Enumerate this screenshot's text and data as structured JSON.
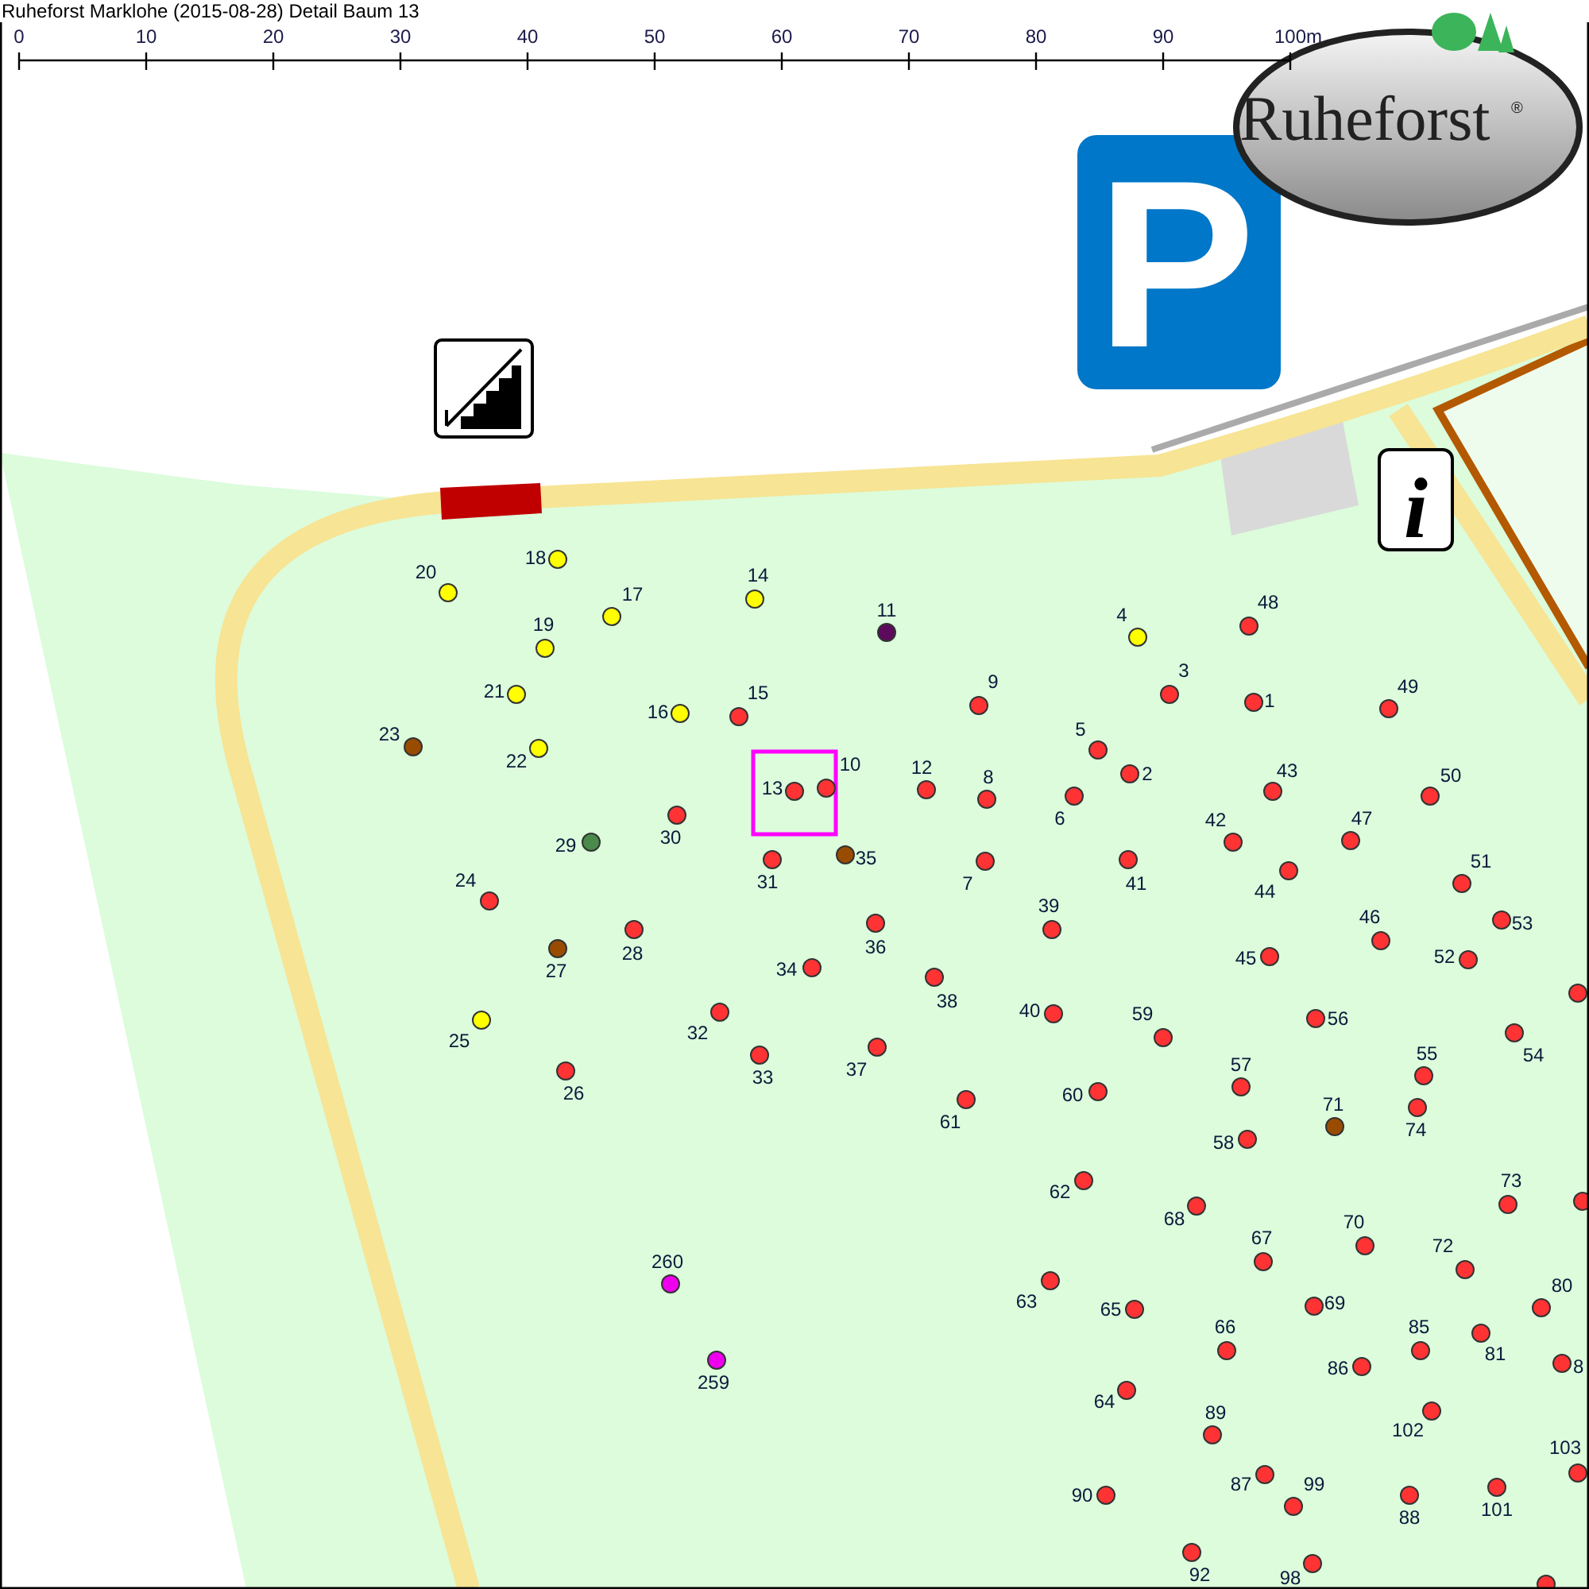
{
  "title": "Ruheforst Marklohe (2015-08-28) Detail  Baum 13",
  "scale_bar": {
    "ticks": [
      "0",
      "10",
      "20",
      "30",
      "40",
      "50",
      "60",
      "70",
      "80",
      "90"
    ],
    "end_label": "100m"
  },
  "logo": {
    "text": "Ruheforst",
    "mark": "®"
  },
  "parking_sign": {
    "letter": "P"
  },
  "info_sign": {
    "letter": "i"
  },
  "trees": [
    {
      "label": "20",
      "color": "#ffff00",
      "selected": false
    },
    {
      "label": "18",
      "color": "#ffff00",
      "selected": false
    },
    {
      "label": "17",
      "color": "#ffff00",
      "selected": false
    },
    {
      "label": "14",
      "color": "#ffff00",
      "selected": false
    },
    {
      "label": "19",
      "color": "#ffff00",
      "selected": false
    },
    {
      "label": "11",
      "color": "#5c0a5c",
      "selected": false
    },
    {
      "label": "4",
      "color": "#ffff00",
      "selected": false
    },
    {
      "label": "48",
      "color": "#ff3333",
      "selected": false
    },
    {
      "label": "21",
      "color": "#ffff00",
      "selected": false
    },
    {
      "label": "16",
      "color": "#ffff00",
      "selected": false
    },
    {
      "label": "15",
      "color": "#ff3333",
      "selected": false
    },
    {
      "label": "9",
      "color": "#ff3333",
      "selected": false
    },
    {
      "label": "3",
      "color": "#ff3333",
      "selected": false
    },
    {
      "label": "1",
      "color": "#ff3333",
      "selected": false
    },
    {
      "label": "49",
      "color": "#ff3333",
      "selected": false
    },
    {
      "label": "23",
      "color": "#994c00",
      "selected": false
    },
    {
      "label": "22",
      "color": "#ffff00",
      "selected": false
    },
    {
      "label": "5",
      "color": "#ff3333",
      "selected": false
    },
    {
      "label": "13",
      "color": "#ff3333",
      "selected": true
    },
    {
      "label": "10",
      "color": "#ff3333",
      "selected": false
    },
    {
      "label": "12",
      "color": "#ff3333",
      "selected": false
    },
    {
      "label": "8",
      "color": "#ff3333",
      "selected": false
    },
    {
      "label": "2",
      "color": "#ff3333",
      "selected": false
    },
    {
      "label": "6",
      "color": "#ff3333",
      "selected": false
    },
    {
      "label": "43",
      "color": "#ff3333",
      "selected": false
    },
    {
      "label": "50",
      "color": "#ff3333",
      "selected": false
    },
    {
      "label": "42",
      "color": "#ff3333",
      "selected": false
    },
    {
      "label": "47",
      "color": "#ff3333",
      "selected": false
    },
    {
      "label": "30",
      "color": "#ff3333",
      "selected": false
    },
    {
      "label": "29",
      "color": "#4a8a4a",
      "selected": false
    },
    {
      "label": "35",
      "color": "#994c00",
      "selected": false
    },
    {
      "label": "31",
      "color": "#ff3333",
      "selected": false
    },
    {
      "label": "7",
      "color": "#ff3333",
      "selected": false
    },
    {
      "label": "41",
      "color": "#ff3333",
      "selected": false
    },
    {
      "label": "44",
      "color": "#ff3333",
      "selected": false
    },
    {
      "label": "51",
      "color": "#ff3333",
      "selected": false
    },
    {
      "label": "24",
      "color": "#ff3333",
      "selected": false
    },
    {
      "label": "36",
      "color": "#ff3333",
      "selected": false
    },
    {
      "label": "39",
      "color": "#ff3333",
      "selected": false
    },
    {
      "label": "28",
      "color": "#ff3333",
      "selected": false
    },
    {
      "label": "46",
      "color": "#ff3333",
      "selected": false
    },
    {
      "label": "53",
      "color": "#ff3333",
      "selected": false
    },
    {
      "label": "27",
      "color": "#994c00",
      "selected": false
    },
    {
      "label": "34",
      "color": "#ff3333",
      "selected": false
    },
    {
      "label": "45",
      "color": "#ff3333",
      "selected": false
    },
    {
      "label": "52",
      "color": "#ff3333",
      "selected": false
    },
    {
      "label": "38",
      "color": "#ff3333",
      "selected": false
    },
    {
      "color": "#ff3333",
      "selected": false
    },
    {
      "label": "40",
      "color": "#ff3333",
      "selected": false
    },
    {
      "label": "32",
      "color": "#ff3333",
      "selected": false
    },
    {
      "label": "59",
      "color": "#ff3333",
      "selected": false
    },
    {
      "label": "56",
      "color": "#ff3333",
      "selected": false
    },
    {
      "label": "54",
      "color": "#ff3333",
      "selected": false
    },
    {
      "label": "25",
      "color": "#ffff00",
      "selected": false
    },
    {
      "label": "33",
      "color": "#ff3333",
      "selected": false
    },
    {
      "label": "37",
      "color": "#ff3333",
      "selected": false
    },
    {
      "label": "26",
      "color": "#ff3333",
      "selected": false
    },
    {
      "label": "57",
      "color": "#ff3333",
      "selected": false
    },
    {
      "label": "55",
      "color": "#ff3333",
      "selected": false
    },
    {
      "label": "60",
      "color": "#ff3333",
      "selected": false
    },
    {
      "label": "61",
      "color": "#ff3333",
      "selected": false
    },
    {
      "label": "71",
      "color": "#994c00",
      "selected": false
    },
    {
      "label": "74",
      "color": "#ff3333",
      "selected": false
    },
    {
      "label": "58",
      "color": "#ff3333",
      "selected": false
    },
    {
      "label": "62",
      "color": "#ff3333",
      "selected": false
    },
    {
      "label": "73",
      "color": "#ff3333",
      "selected": false
    },
    {
      "color": "#ff3333",
      "selected": false
    },
    {
      "label": "68",
      "color": "#ff3333",
      "selected": false
    },
    {
      "label": "70",
      "color": "#ff3333",
      "selected": false
    },
    {
      "label": "72",
      "color": "#ff3333",
      "selected": false
    },
    {
      "label": "67",
      "color": "#ff3333",
      "selected": false
    },
    {
      "label": "80",
      "color": "#ff3333",
      "selected": false
    },
    {
      "label": "260",
      "color": "#ee00ee",
      "selected": false
    },
    {
      "label": "63",
      "color": "#ff3333",
      "selected": false
    },
    {
      "label": "65",
      "color": "#ff3333",
      "selected": false
    },
    {
      "label": "69",
      "color": "#ff3333",
      "selected": false
    },
    {
      "label": "85",
      "color": "#ff3333",
      "selected": false
    },
    {
      "label": "81",
      "color": "#ff3333",
      "selected": false
    },
    {
      "label": "8",
      "color": "#ff3333",
      "selected": false
    },
    {
      "label": "66",
      "color": "#ff3333",
      "selected": false
    },
    {
      "label": "86",
      "color": "#ff3333",
      "selected": false
    },
    {
      "label": "259",
      "color": "#ee00ee",
      "selected": false
    },
    {
      "label": "64",
      "color": "#ff3333",
      "selected": false
    },
    {
      "label": "102",
      "color": "#ff3333",
      "selected": false
    },
    {
      "label": "89",
      "color": "#ff3333",
      "selected": false
    },
    {
      "label": "103",
      "color": "#ff3333",
      "selected": false
    },
    {
      "label": "87",
      "color": "#ff3333",
      "selected": false
    },
    {
      "label": "99",
      "color": "#ff3333",
      "selected": false
    },
    {
      "label": "90",
      "color": "#ff3333",
      "selected": false
    },
    {
      "label": "88",
      "color": "#ff3333",
      "selected": false
    },
    {
      "label": "101",
      "color": "#ff3333",
      "selected": false
    },
    {
      "label": "92",
      "color": "#ff3333",
      "selected": false
    },
    {
      "label": "98",
      "color": "#ff3333",
      "selected": false
    },
    {
      "color": "#ff3333",
      "selected": false
    }
  ]
}
